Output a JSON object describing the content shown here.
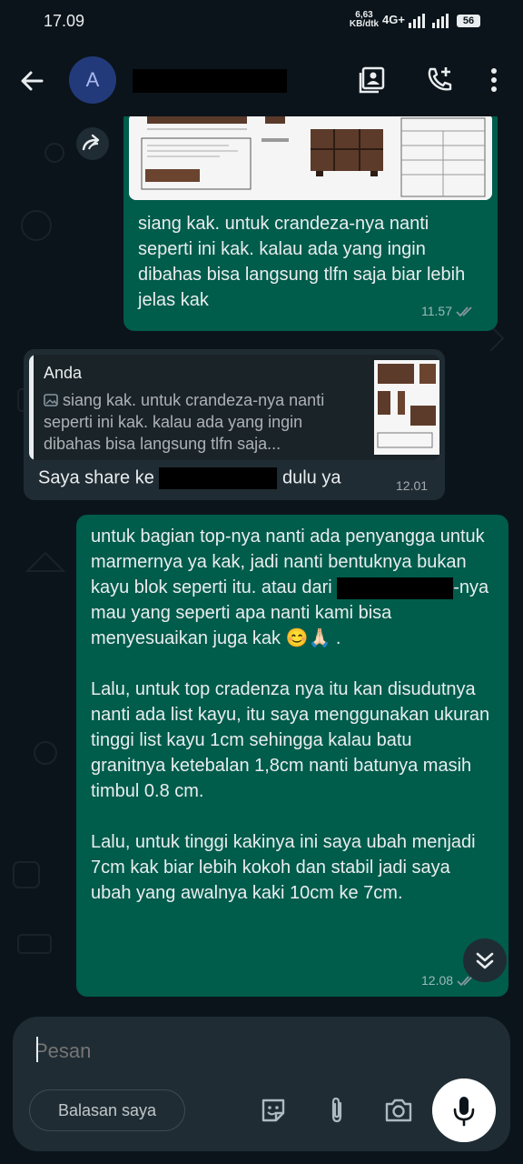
{
  "status_bar": {
    "time": "17.09",
    "speed_value": "6,63",
    "speed_unit": "KB/dtk",
    "network": "4G+",
    "battery": "56"
  },
  "header": {
    "avatar_letter": "A"
  },
  "messages": [
    {
      "direction": "outgoing",
      "text": "siang kak. untuk crandeza-nya nanti seperti ini kak. kalau ada yang ingin dibahas bisa langsung tlfn saja biar lebih jelas kak",
      "time": "11.57"
    },
    {
      "direction": "incoming",
      "quote_author": "Anda",
      "quote_text": "siang kak. untuk crandeza-nya nanti seperti ini kak. kalau ada yang ingin dibahas bisa langsung tlfn saja...",
      "text_before": "Saya share ke",
      "text_after": "dulu ya",
      "time": "12.01"
    },
    {
      "direction": "outgoing",
      "p1_a": "untuk bagian top-nya nanti ada penyangga untuk marmernya ya kak, jadi nanti bentuknya bukan kayu blok seperti itu. atau dari",
      "p1_b": "-nya mau yang seperti apa nanti kami bisa menyesuaikan juga kak 😊🙏🏻 .",
      "p2": "Lalu, untuk top cradenza nya itu kan disudutnya nanti ada list kayu, itu saya menggunakan ukuran tinggi list kayu 1cm sehingga kalau batu granitnya ketebalan 1,8cm nanti batunya masih timbul 0.8 cm.",
      "p3": "Lalu, untuk tinggi kakinya ini saya ubah menjadi 7cm kak biar lebih kokoh dan stabil jadi saya ubah yang awalnya kaki 10cm ke 7cm.",
      "time": "12.08"
    }
  ],
  "composer": {
    "placeholder": "Pesan",
    "chip_label": "Balasan saya"
  },
  "colors": {
    "background": "#0b141a",
    "outgoing_bubble": "#005c4b",
    "incoming_bubble": "#202c33",
    "read_ticks": "#8696a0"
  }
}
